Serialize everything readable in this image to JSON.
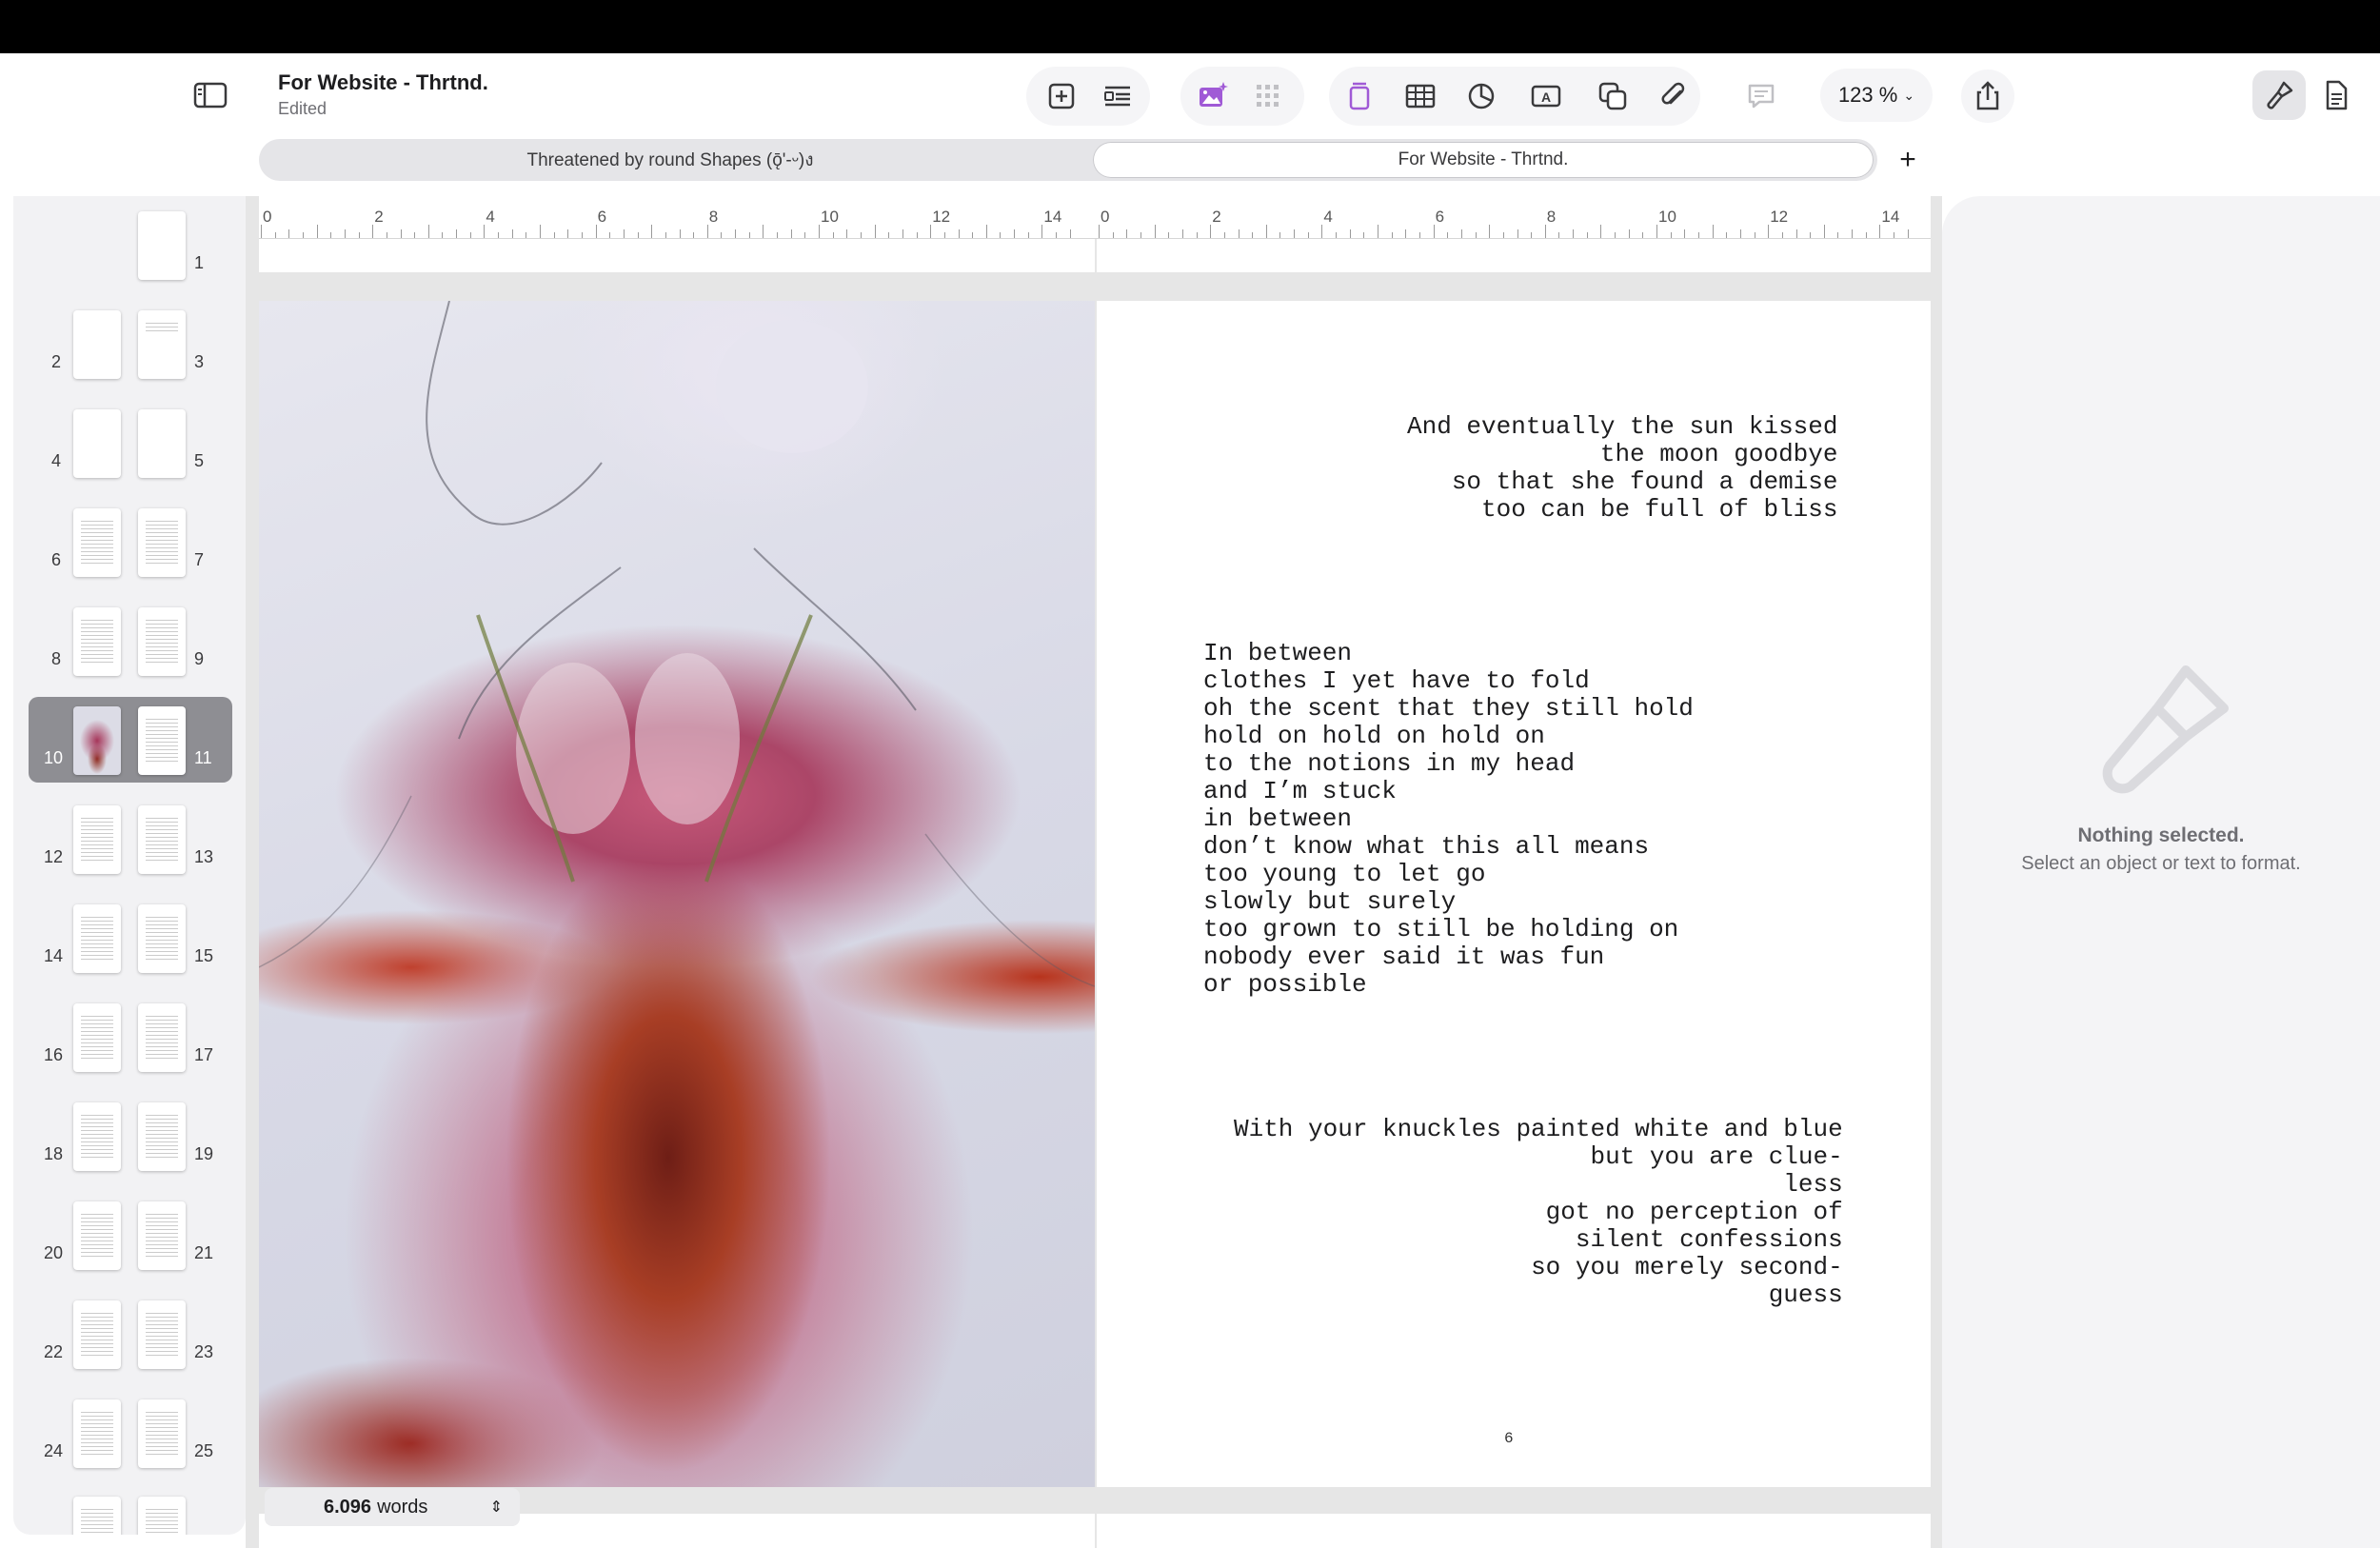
{
  "document": {
    "title": "For Website - Thrtnd.",
    "status": "Edited"
  },
  "tabs": [
    {
      "label": "Threatened by round Shapes (ǭ'-ᵕ)ง",
      "active": false
    },
    {
      "label": "For Website - Thrtnd.",
      "active": true
    }
  ],
  "toolbar": {
    "zoom": "123 %",
    "icons": [
      "sidebar-icon",
      "insert-page-icon",
      "insert-text-icon",
      "media-icon",
      "grid-icon",
      "page-icon",
      "table-icon",
      "chart-icon",
      "textbox-icon",
      "shape-icon",
      "attachment-icon",
      "comment-icon",
      "share-icon",
      "format-icon",
      "document-icon"
    ]
  },
  "ruler": {
    "labels": [
      "0",
      "2",
      "4",
      "6",
      "8",
      "10",
      "12",
      "14",
      "0",
      "2",
      "4",
      "6",
      "8",
      "10",
      "12",
      "14"
    ]
  },
  "page_thumbnails": [
    {
      "num": "1"
    },
    {
      "num": "2"
    },
    {
      "num": "3"
    },
    {
      "num": "4"
    },
    {
      "num": "5"
    },
    {
      "num": "6"
    },
    {
      "num": "7"
    },
    {
      "num": "8"
    },
    {
      "num": "9"
    },
    {
      "num": "10"
    },
    {
      "num": "11"
    },
    {
      "num": "12"
    },
    {
      "num": "13"
    },
    {
      "num": "14"
    },
    {
      "num": "15"
    },
    {
      "num": "16"
    },
    {
      "num": "17"
    },
    {
      "num": "18"
    },
    {
      "num": "19"
    },
    {
      "num": "20"
    },
    {
      "num": "21"
    },
    {
      "num": "22"
    },
    {
      "num": "23"
    },
    {
      "num": "24"
    },
    {
      "num": "25"
    }
  ],
  "poems": {
    "stanza1": [
      "And eventually the sun kissed",
      "the moon goodbye",
      "so that she found a demise",
      "too can be full of bliss"
    ],
    "stanza2": [
      "In between",
      "clothes I yet have to fold",
      "oh the scent that they still hold",
      "hold on hold on hold on",
      "to the notions in my head",
      "and I’m stuck",
      "in between",
      "don’t know what this all means",
      "too young to let go",
      "slowly but surely",
      "too grown to still be holding on",
      "nobody ever said it was fun",
      "or possible"
    ],
    "stanza3": [
      "With your knuckles painted white and blue",
      "but you are clue-",
      "less",
      "got no perception of",
      "silent confessions",
      "so you merely second-",
      "guess"
    ]
  },
  "page_number": "6",
  "status_bar": {
    "word_count": "6.096",
    "word_label": "words"
  },
  "inspector": {
    "title": "Nothing selected.",
    "subtitle": "Select an object or text to format."
  }
}
